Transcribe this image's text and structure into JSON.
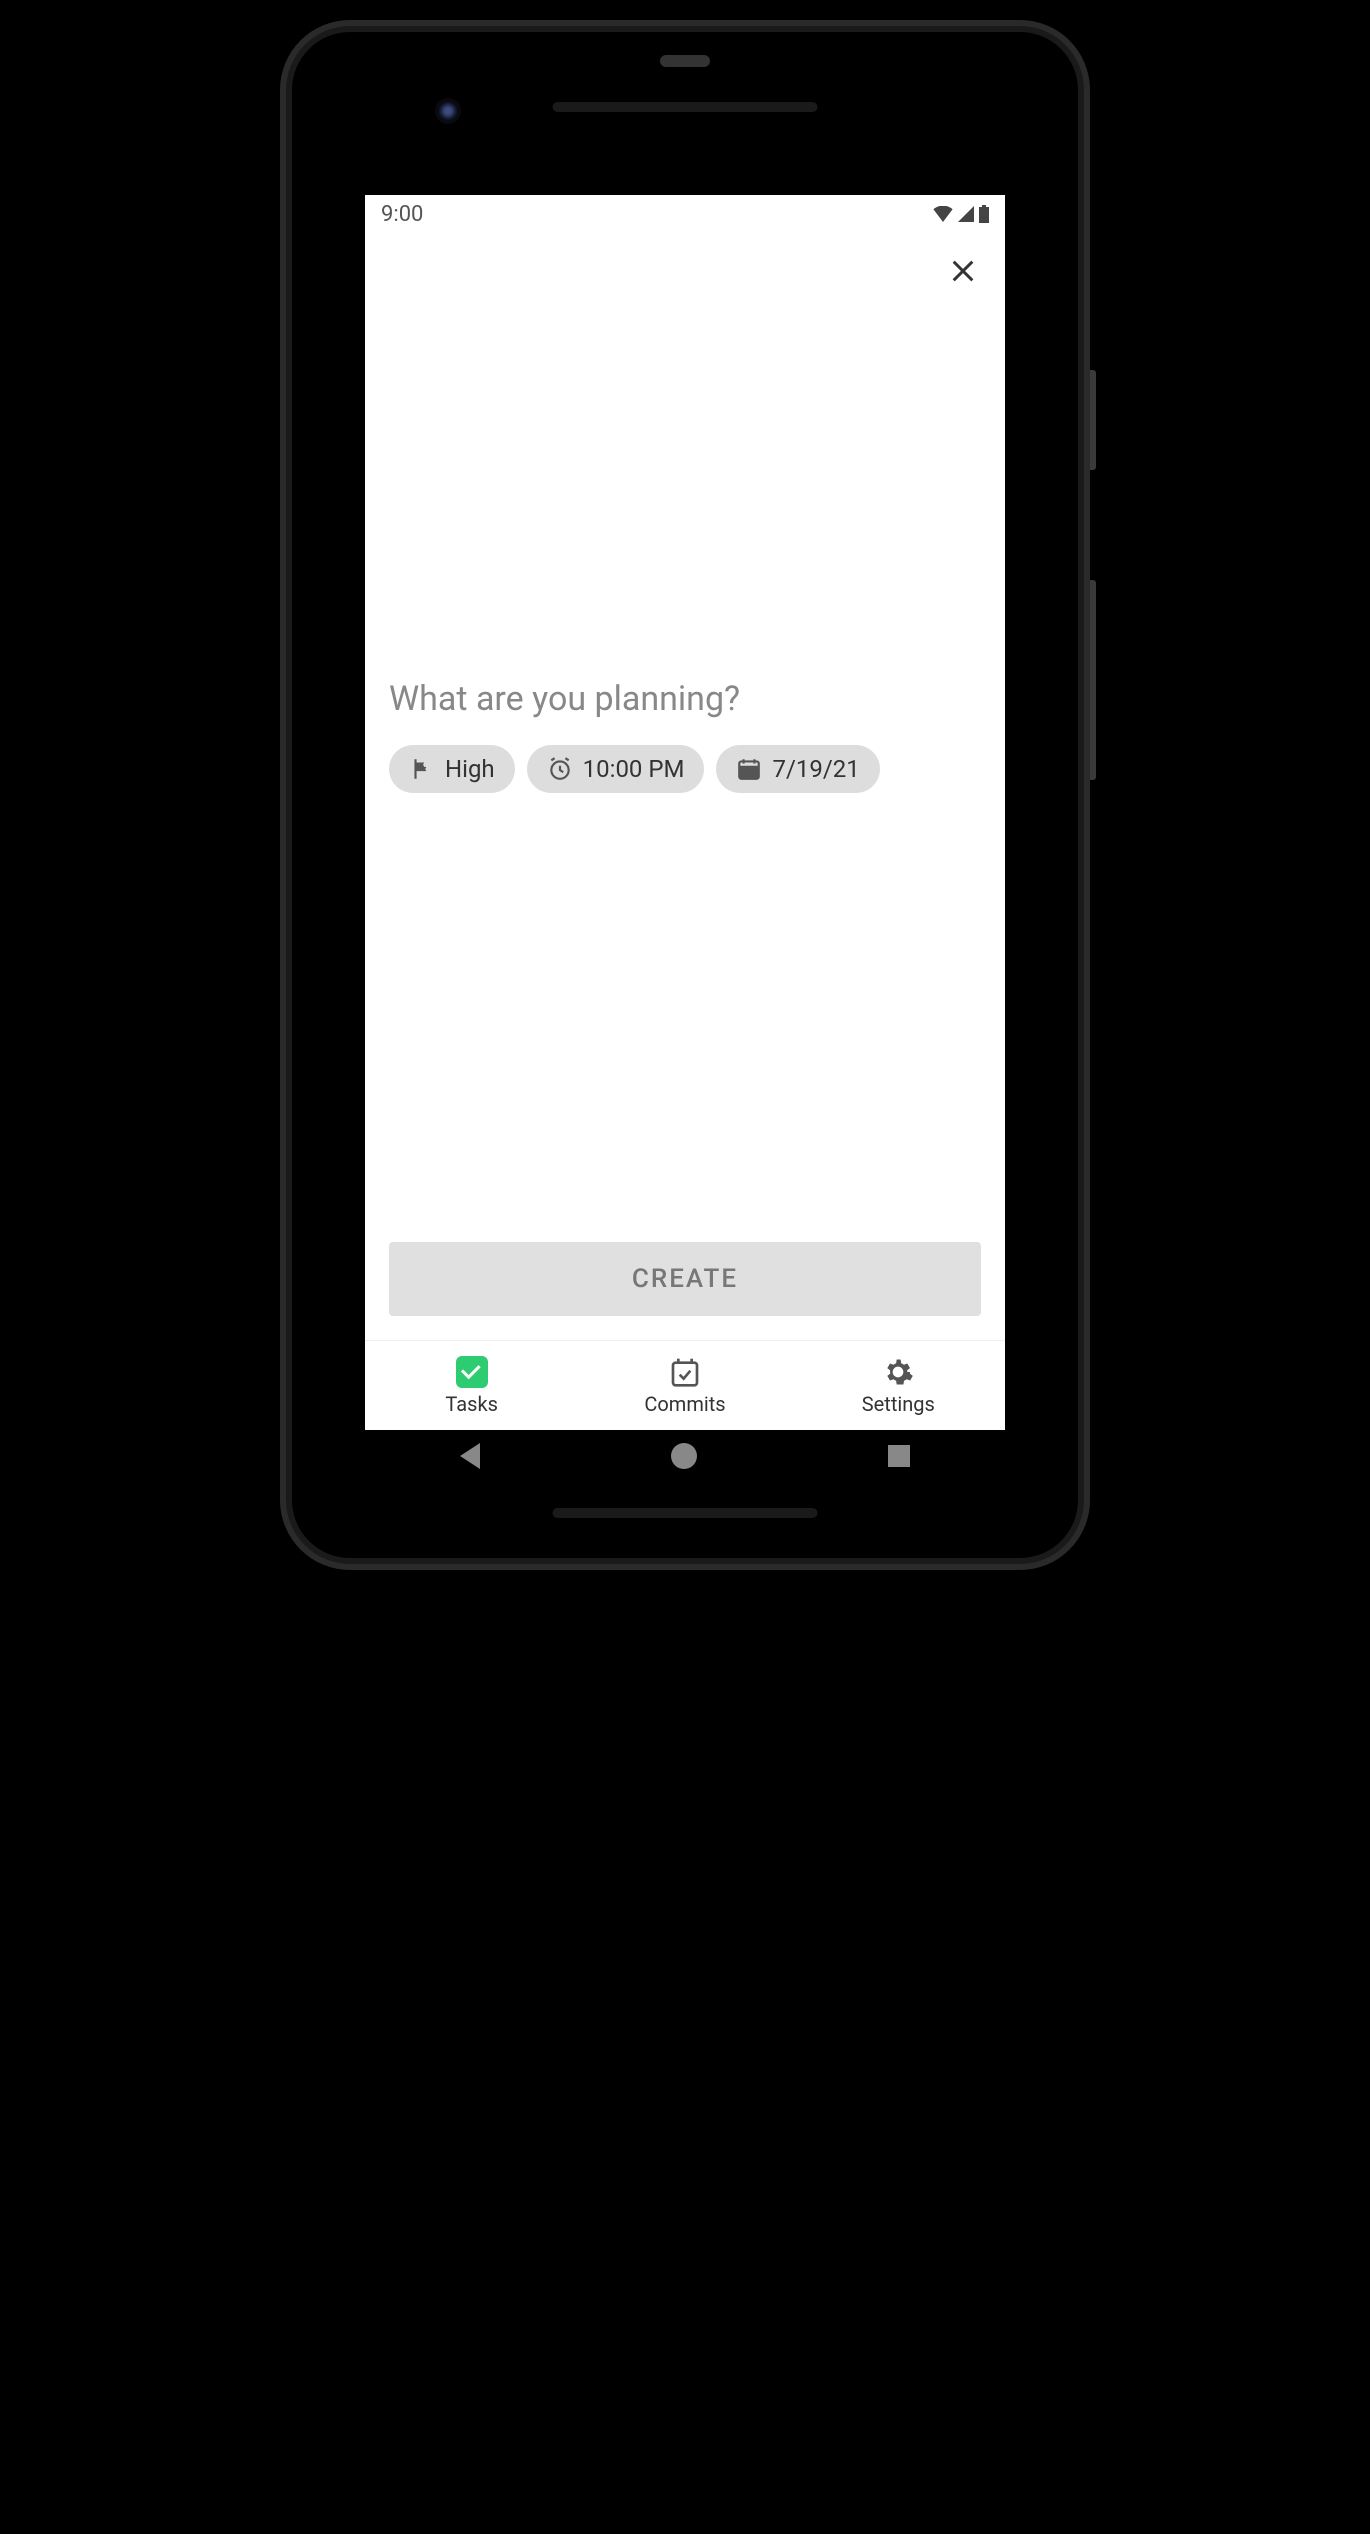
{
  "status_bar": {
    "time": "9:00"
  },
  "input": {
    "placeholder": "What are you planning?"
  },
  "chips": {
    "priority": {
      "label": "High"
    },
    "time": {
      "label": "10:00 PM"
    },
    "date": {
      "label": "7/19/21"
    }
  },
  "create_button": {
    "label": "CREATE"
  },
  "bottom_nav": {
    "tasks": {
      "label": "Tasks"
    },
    "commits": {
      "label": "Commits"
    },
    "settings": {
      "label": "Settings"
    }
  }
}
